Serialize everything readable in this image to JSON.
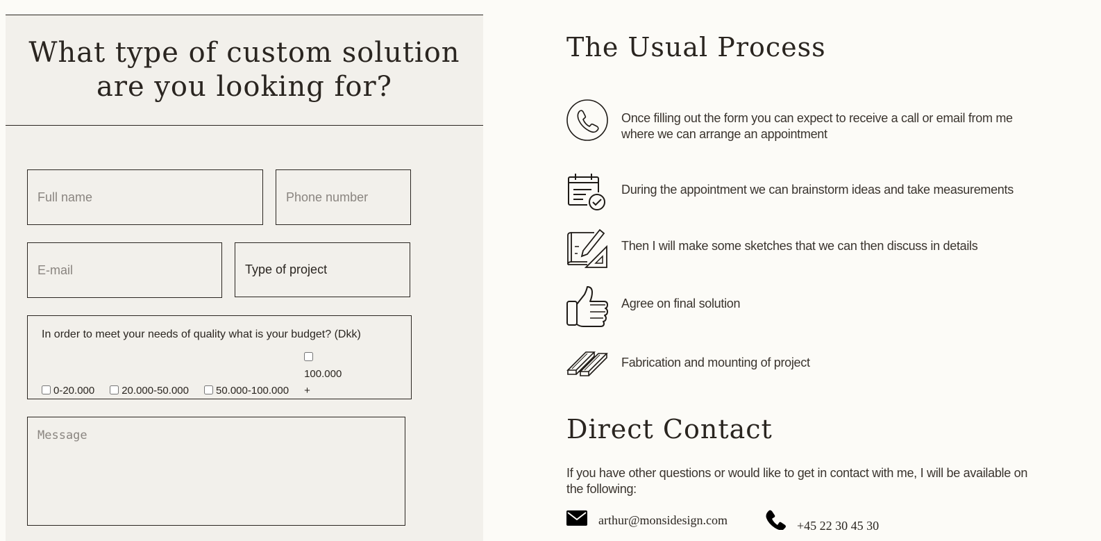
{
  "form": {
    "title": "What type of custom solution are you looking for?",
    "fields": {
      "full_name_placeholder": "Full name",
      "phone_placeholder": "Phone number",
      "email_placeholder": "E-mail",
      "project_type_value": "Type of project",
      "message_placeholder": "Message"
    },
    "budget": {
      "question": "In order to meet your needs of quality what is your budget? (Dkk)",
      "options": [
        "0-20.000",
        "20.000-50.000",
        "50.000-100.000",
        "100.000 +"
      ]
    }
  },
  "process": {
    "title": "The Usual Process",
    "steps": [
      {
        "icon": "phone-circle-icon",
        "text": "Once filling out the form you can expect to receive a call or email from me where we can arrange an appointment"
      },
      {
        "icon": "calendar-check-icon",
        "text": "During the appointment we can brainstorm ideas and take measurements"
      },
      {
        "icon": "blueprint-pencil-icon",
        "text": "Then I will make some sketches that we can then discuss in details"
      },
      {
        "icon": "thumbs-up-icon",
        "text": "Agree on final solution"
      },
      {
        "icon": "wood-planks-icon",
        "text": "Fabrication and mounting of project"
      }
    ]
  },
  "contact": {
    "title": "Direct Contact",
    "intro": "If you have other questions or would like to get in contact with me, I will be available on the following:",
    "email": "arthur@monsidesign.com",
    "phone": "+45 22 30 45 30"
  },
  "colors": {
    "page_bg": "#fcfbf7",
    "panel_bg": "#f2f0eb",
    "ink": "#2a2520"
  }
}
